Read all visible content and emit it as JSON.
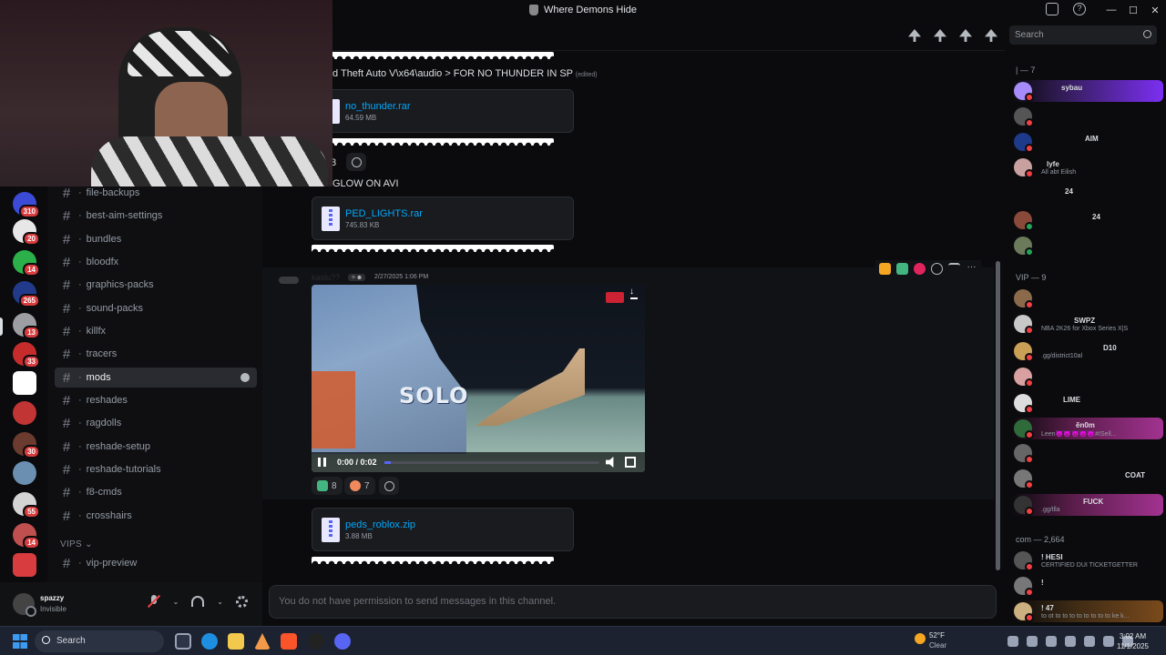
{
  "window": {
    "title": "Where Demons Hide",
    "controls": [
      "—",
      "☐",
      "✕"
    ]
  },
  "header": {
    "search_placeholder": "Search"
  },
  "servers": [
    {
      "badge": "310",
      "color": "#3b4bd6"
    },
    {
      "badge": "20",
      "color": "#e7e7e7"
    },
    {
      "badge": "14",
      "color": "#2bb04a"
    },
    {
      "badge": "265",
      "color": "#223a8a"
    },
    {
      "badge": "13",
      "color": "#9c9ea3"
    },
    {
      "badge": "33",
      "color": "#c72c2c"
    },
    {
      "badge": "",
      "color": "#ffffff"
    },
    {
      "badge": "",
      "color": "#c23535"
    },
    {
      "badge": "30",
      "color": "#6a3b2e"
    },
    {
      "badge": "",
      "color": "#6a8fb0"
    },
    {
      "badge": "55",
      "color": "#d4d4d4"
    },
    {
      "badge": "14",
      "color": "#c05050"
    },
    {
      "badge": "",
      "color": "#d83c3e"
    }
  ],
  "sidebar": {
    "channels": [
      {
        "label": "file-backups"
      },
      {
        "label": "best-aim-settings"
      },
      {
        "label": "bundles"
      },
      {
        "label": "bloodfx"
      },
      {
        "label": "graphics-packs"
      },
      {
        "label": "sound-packs"
      },
      {
        "label": "killfx"
      },
      {
        "label": "tracers"
      },
      {
        "label": "mods",
        "active": true
      },
      {
        "label": "reshades"
      },
      {
        "label": "ragdolls"
      },
      {
        "label": "reshade-setup"
      },
      {
        "label": "reshade-tutorials"
      },
      {
        "label": "f8-cmds"
      },
      {
        "label": "crosshairs"
      }
    ],
    "vip_category": "VIPS",
    "vip_channels": [
      {
        "label": "vip-preview"
      }
    ]
  },
  "user": {
    "name": "spazzy",
    "status": "Invisible"
  },
  "messages": {
    "line1": "d Theft Auto V\\x64\\audio > FOR NO THUNDER IN SP",
    "edited": "(edited)",
    "file1": {
      "name": "no_thunder.rar",
      "size": "64.59 MB"
    },
    "reaction_count_partial": "3",
    "line2": "GLOW ON AVI",
    "file2": {
      "name": "PED_LIGHTS.rar",
      "size": "745.83 KB"
    },
    "video_msg": {
      "author": "kaslu??",
      "tag": "✧☻",
      "timestamp": "2/27/2025 1:06 PM",
      "graffiti": "SOLO",
      "time": "0:00 / 0:02",
      "progress": 0.03
    },
    "reactions": [
      {
        "emoji": "check",
        "count": "8"
      },
      {
        "emoji": "peach",
        "count": "7"
      }
    ],
    "file3": {
      "name": "peds_roblox.zip",
      "size": "3.88 MB"
    }
  },
  "input": {
    "placeholder": "You do not have permission to send messages in this channel."
  },
  "members": {
    "top_category": "| — 7",
    "top": [
      {
        "name": "sybau",
        "sub": "",
        "color": "#a78bfa"
      },
      {
        "name": "",
        "sub": "",
        "color": "#555"
      },
      {
        "name": "AIM",
        "sub": "",
        "color": "#1e3a8a"
      },
      {
        "name": "lyfe",
        "sub": "All abt Eilish",
        "color": "#c9a0a0"
      },
      {
        "name": "24",
        "sub": "",
        "color": "#444"
      },
      {
        "name": "24",
        "sub": "",
        "color": "#8a4a3a"
      },
      {
        "name": "",
        "sub": "",
        "color": "#6a7a5a"
      }
    ],
    "vip_category": "VIP — 9",
    "vip": [
      {
        "name": "",
        "sub": "",
        "color": "#8a6a4a"
      },
      {
        "name": "SWPZ",
        "sub": "NBA 2K26 for Xbox Series X|S",
        "color": "#c8c8c8"
      },
      {
        "name": "D10",
        "sub": ".gg/district10al",
        "color": "#c9a055"
      },
      {
        "name": "",
        "sub": "",
        "color": "#d8a0a0"
      },
      {
        "name": "LIME",
        "sub": "",
        "color": "#ddd"
      },
      {
        "name": "ẽn0m",
        "sub": "Leen😈😈😈😈😈#ISell...",
        "color": "#2f6b3a"
      },
      {
        "name": "",
        "sub": "",
        "color": "#666"
      },
      {
        "name": "COAT",
        "sub": "",
        "color": "#777"
      },
      {
        "name": "FUCK",
        "sub": ".gg/tlla",
        "color": "#333"
      }
    ],
    "com_category": "com — 2,664",
    "com": [
      {
        "name": "! HESI",
        "sub": "CERTIFIED DUI TICKETGETTER",
        "color": "#555"
      },
      {
        "name": "!",
        "sub": "",
        "color": "#777"
      },
      {
        "name": "! 47",
        "sub": "to ot to to to to to to to to ke k...",
        "color": "#cdb080"
      }
    ]
  },
  "taskbar": {
    "search": "Search",
    "weather_temp": "52°F",
    "weather_cond": "Clear",
    "weather_badge": "2",
    "time": "3:02 AM",
    "date": "11/1/2025"
  }
}
